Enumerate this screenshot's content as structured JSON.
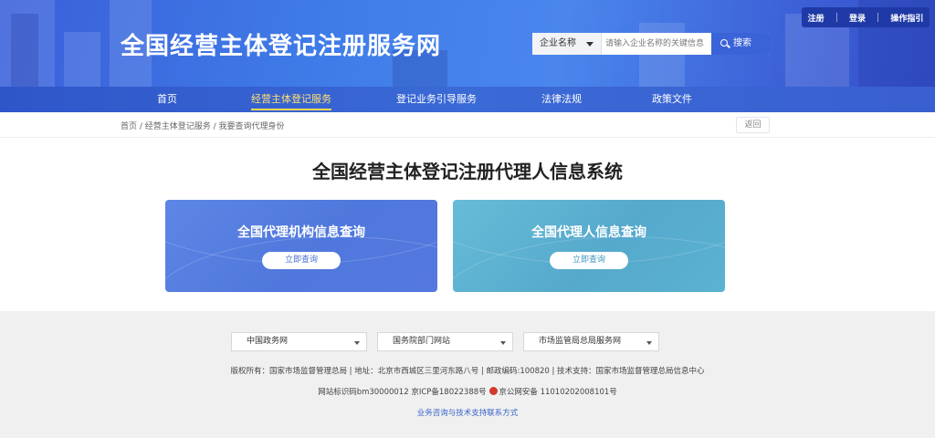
{
  "header": {
    "site_title": "全国经营主体登记注册服务网",
    "search": {
      "select_value": "企业名称",
      "placeholder": "请输入企业名称的关键信息",
      "button_label": "搜索"
    },
    "top_links": [
      "注册",
      "登录",
      "操作指引"
    ]
  },
  "nav": {
    "items": [
      {
        "label": "首页"
      },
      {
        "label": "经营主体登记服务"
      },
      {
        "label": "登记业务引导服务"
      },
      {
        "label": "法律法规"
      },
      {
        "label": "政策文件"
      }
    ],
    "active_index": 1
  },
  "breadcrumb": {
    "text": "首页 / 经营主体登记服务 / 我要查询代理身份",
    "back_label": "返回"
  },
  "main": {
    "title": "全国经营主体登记注册代理人信息系统",
    "cards": [
      {
        "title": "全国代理机构信息查询",
        "button": "立即查询"
      },
      {
        "title": "全国代理人信息查询",
        "button": "立即查询"
      }
    ]
  },
  "footer": {
    "selects": [
      "中国政务网",
      "国务院部门网站",
      "市场监管局总局服务网"
    ],
    "copyright": "版权所有：国家市场监督管理总局 | 地址：北京市西城区三里河东路八号 | 邮政编码:100820 | 技术支持：国家市场监督管理总局信息中心",
    "id_line_a": "网站标识码bm30000012 京ICP备18022388号",
    "id_line_b": "京公网安备 11010202008101号",
    "contact_link": "业务咨询与技术支持联系方式"
  },
  "colors": {
    "brand_blue": "#3b63d8",
    "nav_active": "#ffe070",
    "card1": "#5478e0",
    "card2": "#56a9cc"
  }
}
